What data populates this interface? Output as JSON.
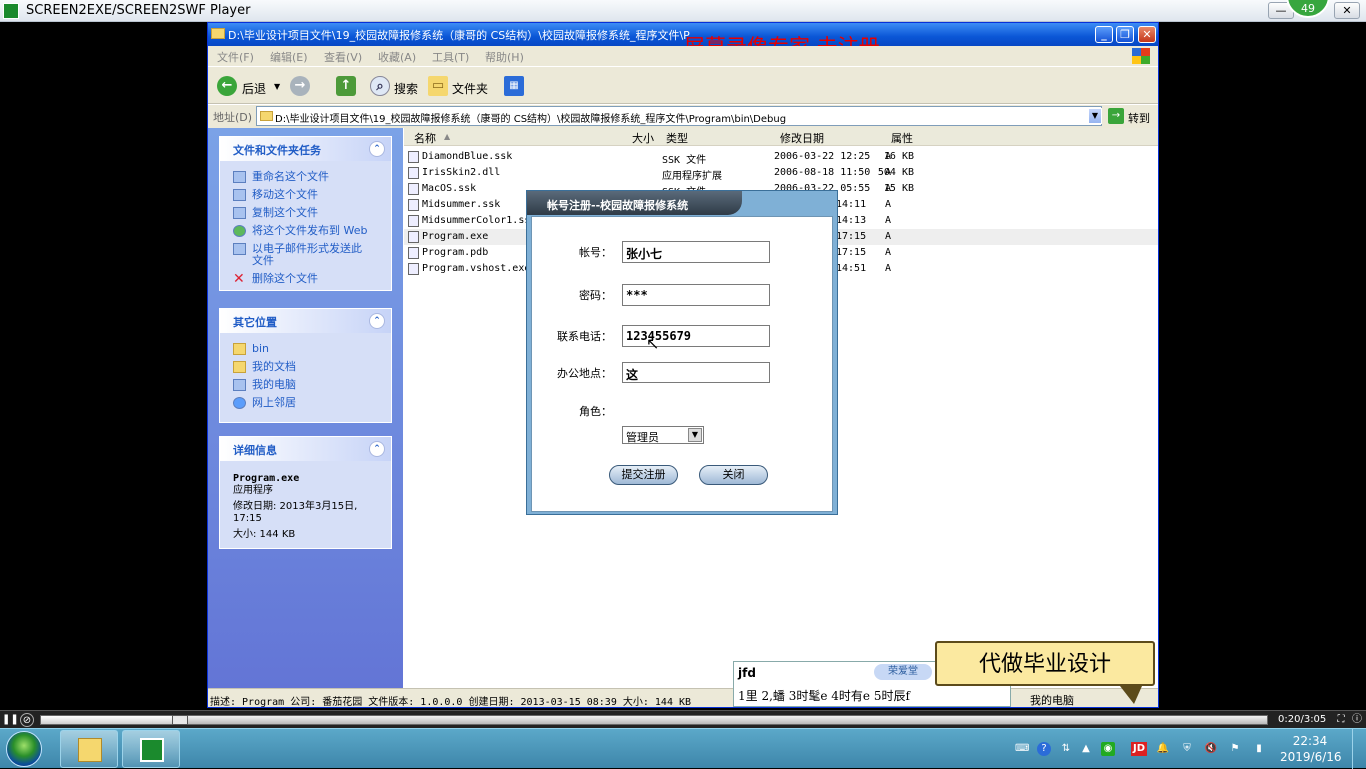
{
  "player": {
    "title": "SCREEN2EXE/SCREEN2SWF Player",
    "badge": "49",
    "buttons": {
      "minimize": "—",
      "restore": "❐",
      "close": "✕"
    }
  },
  "explorer": {
    "title": "D:\\毕业设计项目文件\\19_校园故障报修系统（康哥的 CS结构）\\校园故障报修系统_程序文件\\P",
    "watermark": "屏幕录像专家  未注册",
    "menu": [
      "文件(F)",
      "编辑(E)",
      "查看(V)",
      "收藏(A)",
      "工具(T)",
      "帮助(H)"
    ],
    "toolbar": {
      "back": "后退",
      "search": "搜索",
      "folders": "文件夹"
    },
    "address": {
      "label": "地址(D)",
      "value": "D:\\毕业设计项目文件\\19_校园故障报修系统（康哥的 CS结构）\\校园故障报修系统_程序文件\\Program\\bin\\Debug",
      "go": "转到"
    },
    "tasks": {
      "title": "文件和文件夹任务",
      "items": [
        "重命名这个文件",
        "移动这个文件",
        "复制这个文件",
        "将这个文件发布到 Web",
        "以电子邮件形式发送此文件",
        "删除这个文件"
      ]
    },
    "places": {
      "title": "其它位置",
      "items": [
        "bin",
        "我的文档",
        "我的电脑",
        "网上邻居"
      ]
    },
    "details": {
      "title": "详细信息",
      "name": "Program.exe",
      "type": "应用程序",
      "modified": "修改日期: 2013年3月15日, 17:15",
      "size": "大小: 144 KB"
    },
    "columns": {
      "name": "名称",
      "size": "大小",
      "type": "类型",
      "date": "修改日期",
      "attr": "属性"
    },
    "files": [
      {
        "name": "DiamondBlue.ssk",
        "size": "16 KB",
        "type": "SSK 文件",
        "date": "2006-03-22 12:25",
        "attr": "A"
      },
      {
        "name": "IrisSkin2.dll",
        "size": "504 KB",
        "type": "应用程序扩展",
        "date": "2006-08-18 11:50",
        "attr": "A"
      },
      {
        "name": "MacOS.ssk",
        "size": "15 KB",
        "type": "SSK 文件",
        "date": "2006-03-22 05:55",
        "attr": "A"
      },
      {
        "name": "Midsummer.ssk",
        "size": "",
        "type": "",
        "date": "14:11",
        "attr": "A"
      },
      {
        "name": "MidsummerColor1.ssk",
        "size": "",
        "type": "",
        "date": "14:13",
        "attr": "A"
      },
      {
        "name": "Program.exe",
        "size": "",
        "type": "",
        "date": "17:15",
        "attr": "A"
      },
      {
        "name": "Program.pdb",
        "size": "",
        "type": "",
        "date": "17:15",
        "attr": "A"
      },
      {
        "name": "Program.vshost.exe",
        "size": "",
        "type": "",
        "date": "14:51",
        "attr": "A"
      }
    ],
    "status": "描述: Program 公司: 番茄花园 文件版本: 1.0.0.0 创建日期: 2013-03-15 08:39 大小: 144 KB",
    "status_location": "我的电脑"
  },
  "dialog": {
    "title": "帐号注册--校园故障报修系统",
    "fields": {
      "account": {
        "label": "帐号：",
        "value": "张小七"
      },
      "password": {
        "label": "密码：",
        "value": "***"
      },
      "phone": {
        "label": "联系电话：",
        "value": "123455679"
      },
      "office": {
        "label": "办公地点：",
        "value": "这"
      },
      "role": {
        "label": "角色：",
        "value": "管理员"
      }
    },
    "submit": "提交注册",
    "close": "关闭"
  },
  "ime": {
    "composition": "jfd",
    "skin": "荣爱堂",
    "candidates": "1里 2,蟠 3时髦e 4时有e 5时辰f"
  },
  "promo": "代做毕业设计",
  "playback": {
    "time": "0:20/3:05",
    "progress": 0.11
  },
  "taskbar": {
    "time": "22:34",
    "date": "2019/6/16",
    "tray_badge": "JD"
  }
}
